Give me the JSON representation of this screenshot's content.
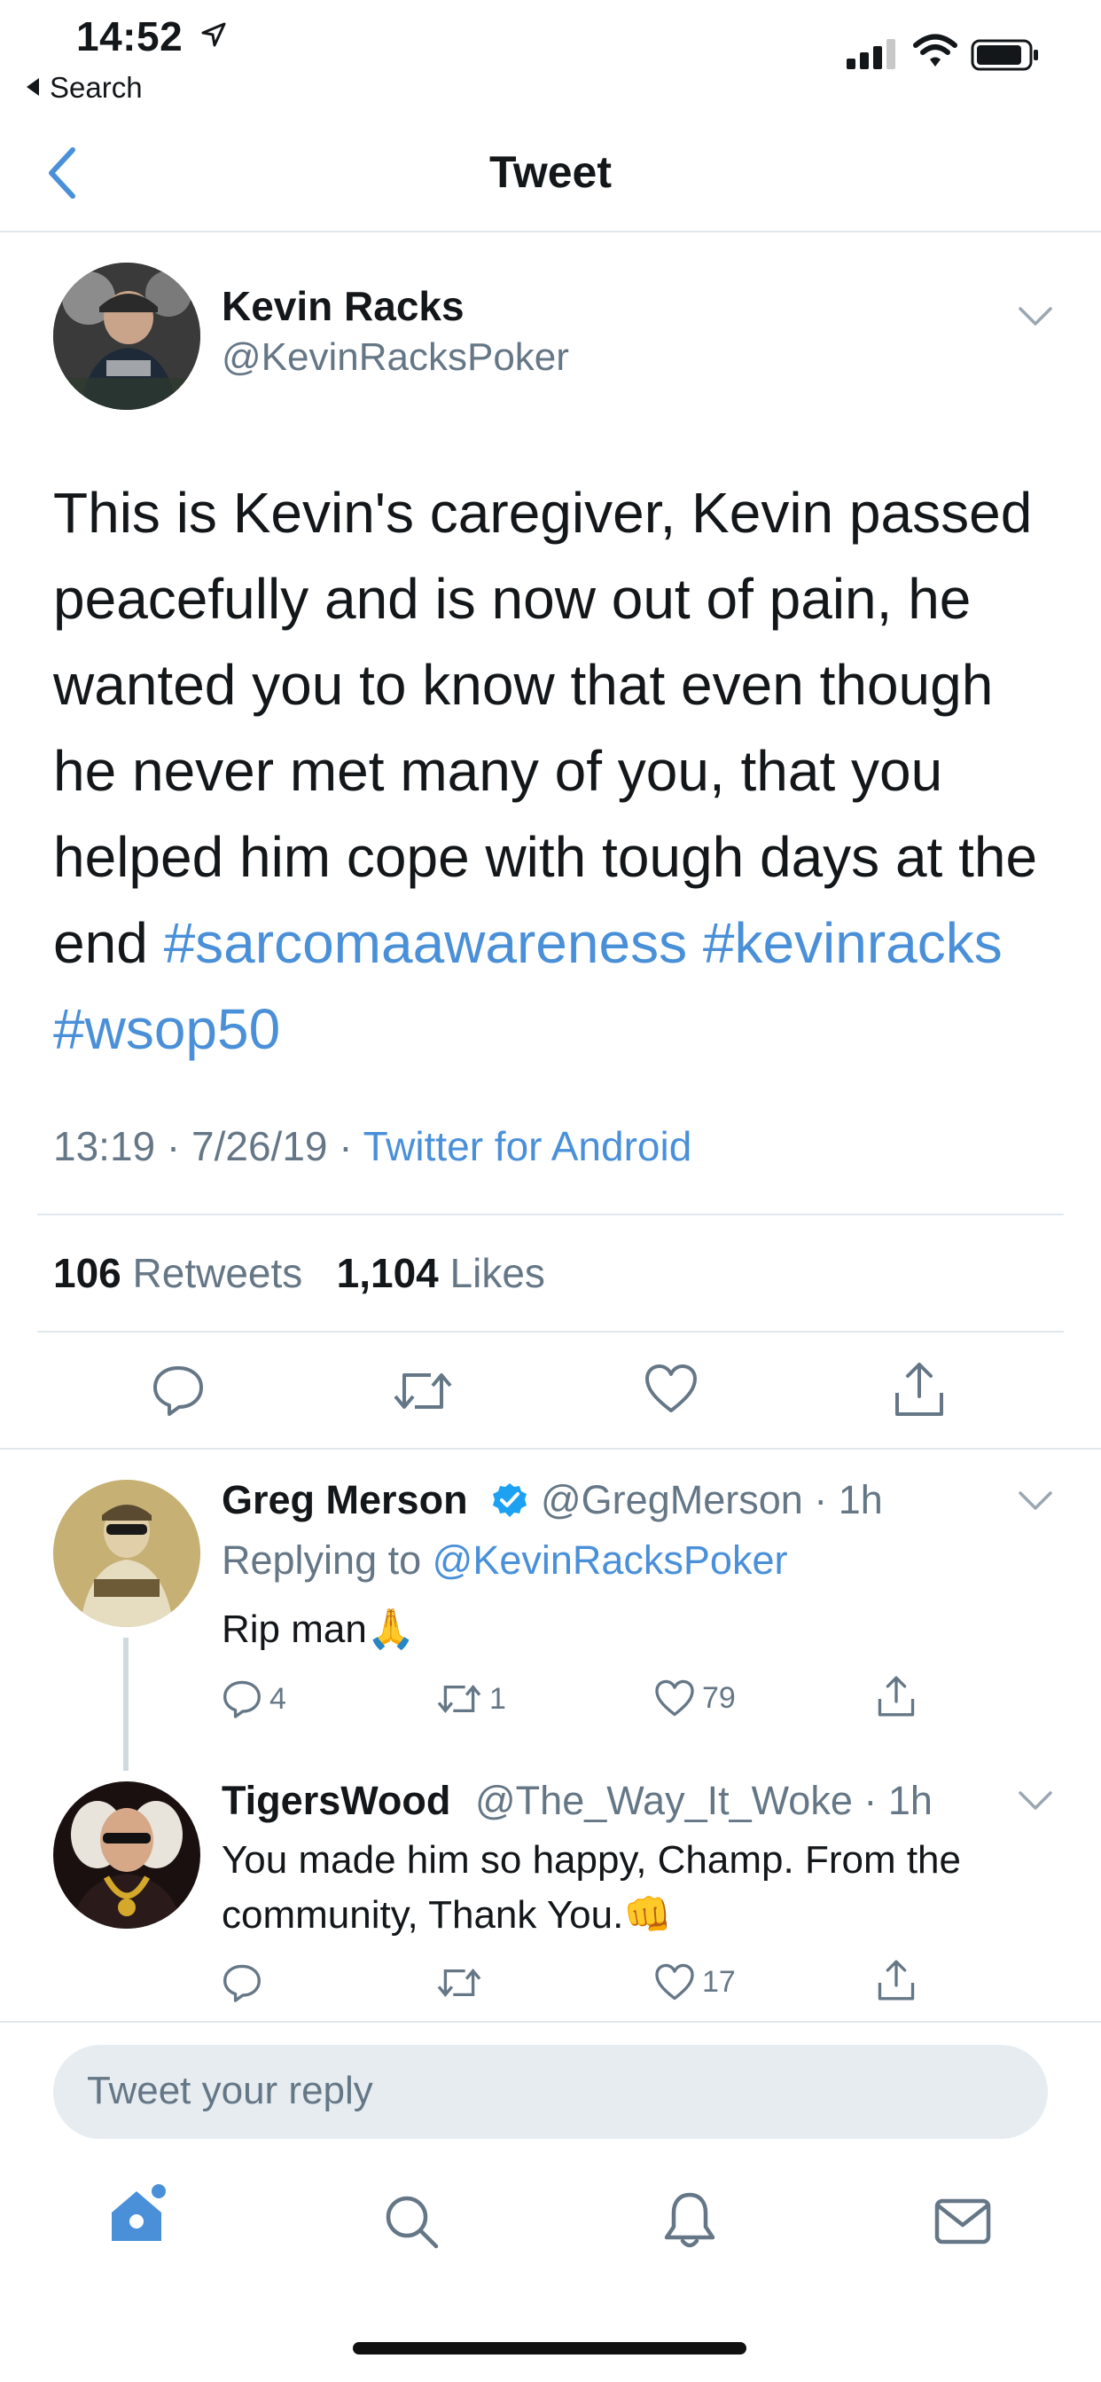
{
  "status_bar": {
    "time": "14:52",
    "back_label": "Search"
  },
  "nav": {
    "title": "Tweet"
  },
  "tweet": {
    "name": "Kevin Racks",
    "handle": "@KevinRacksPoker",
    "text_plain": "This is Kevin's caregiver, Kevin passed peacefully and is now out of pain, he wanted you to know that even though he never met many of you, that you helped him cope with tough days at the end ",
    "hashtags": [
      "#sarcomaawareness",
      "#kevinracks",
      "#wsop50"
    ],
    "time": "13:19",
    "date": "7/26/19",
    "source": "Twitter for Android",
    "retweets_count": "106",
    "retweets_label": "Retweets",
    "likes_count": "1,104",
    "likes_label": "Likes"
  },
  "replies": [
    {
      "name": "Greg Merson",
      "verified": true,
      "handle": "@GregMerson",
      "age": "1h",
      "replying_prefix": "Replying to ",
      "replying_to": "@KevinRacksPoker",
      "text": "Rip man",
      "emoji": "🙏",
      "reply_count": "4",
      "retweet_count": "1",
      "like_count": "79"
    },
    {
      "name": "TigersWood",
      "verified": false,
      "handle": "@The_Way_It_Woke",
      "age": "1h",
      "text_line1": "You made him so happy, Champ. From the",
      "text_line2": "community, Thank You.",
      "emoji": "👊",
      "reply_count": "",
      "retweet_count": "",
      "like_count": "17"
    }
  ],
  "compose": {
    "placeholder": "Tweet your reply"
  },
  "colors": {
    "accent": "#4a90d9",
    "verified": "#1da1f2",
    "secondary_text": "#657786",
    "divider": "#e1e8ed"
  },
  "tab_bar": [
    "home-icon",
    "search-icon",
    "notifications-icon",
    "messages-icon"
  ]
}
